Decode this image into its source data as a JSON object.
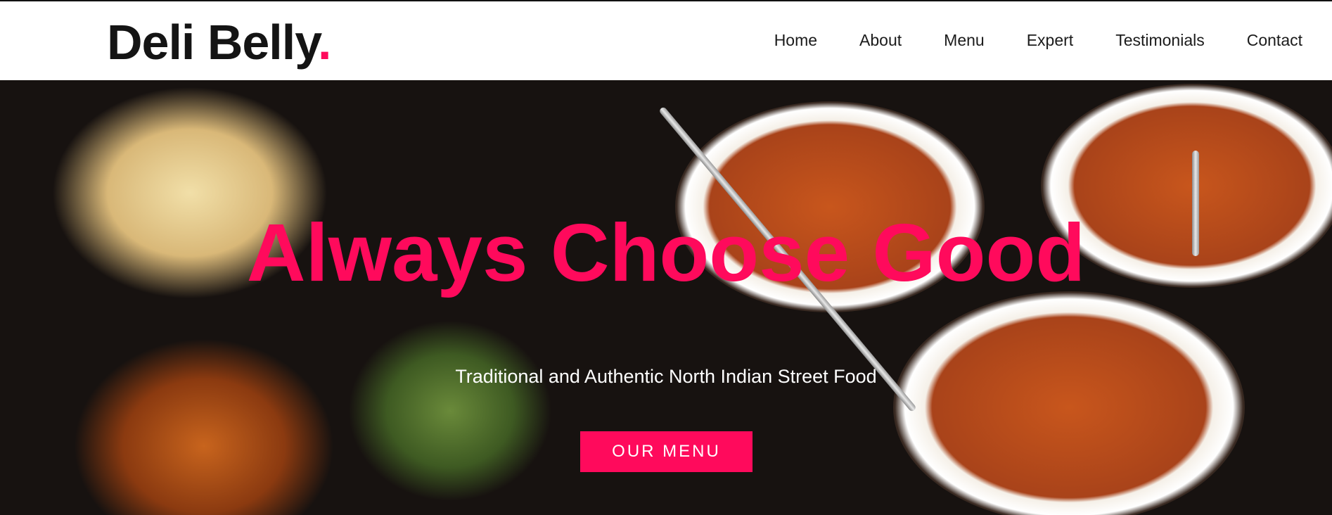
{
  "brand": {
    "name": "Deli Belly",
    "dot": "."
  },
  "nav": {
    "items": [
      "Home",
      "About",
      "Menu",
      "Expert",
      "Testimonials",
      "Contact"
    ]
  },
  "hero": {
    "title": "Always Choose Good",
    "subtitle": "Traditional and Authentic North Indian Street Food",
    "cta_label": "OUR MENU",
    "image_alt": "Indian food: naan basket, pakoras with salad, and curry bowls"
  },
  "colors": {
    "accent": "#ff0a5c",
    "text": "#141414",
    "hero_text": "#ffffff"
  }
}
